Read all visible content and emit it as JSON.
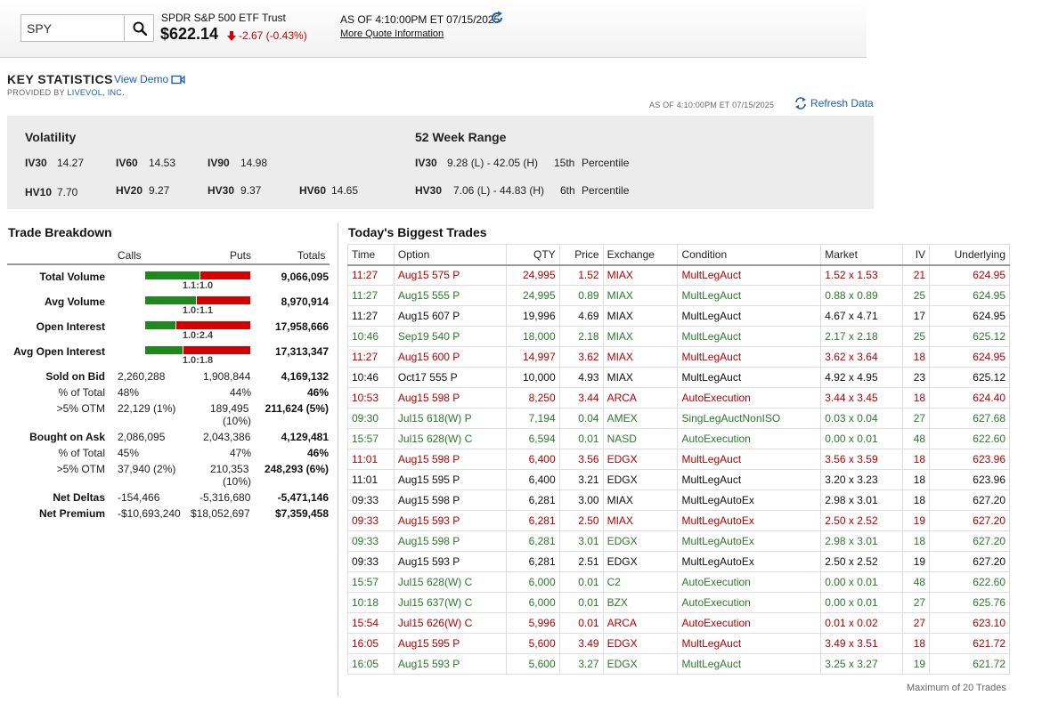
{
  "quote": {
    "symbol": "SPY",
    "name": "SPDR S&P 500 ETF Trust",
    "price": "$622.14",
    "change": "-2.67 (-0.43%)",
    "asof": "AS OF 4:10:00PM ET 07/15/2025",
    "more_info": "More Quote Information"
  },
  "key_stats": {
    "title": "KEY STATISTICS",
    "view_demo": "View Demo",
    "provided_by": "PROVIDED BY",
    "provider": "LIVEVOL, INC.",
    "asof": "AS OF 4:10:00PM ET 07/15/2025",
    "refresh": "Refresh Data",
    "volatility": {
      "heading": "Volatility",
      "iv30_label": "IV30",
      "iv30": "14.27",
      "iv60_label": "IV60",
      "iv60": "14.53",
      "iv90_label": "IV90",
      "iv90": "14.98",
      "hv10_label": "HV10",
      "hv10": "7.70",
      "hv20_label": "HV20",
      "hv20": "9.27",
      "hv30_label": "HV30",
      "hv30": "9.37",
      "hv60_label": "HV60",
      "hv60": "14.65"
    },
    "range52": {
      "heading": "52 Week Range",
      "iv30_label": "IV30",
      "iv30_range": "9.28 (L) - 42.05 (H)",
      "iv30_pct": "15th",
      "pct_label": "Percentile",
      "hv30_label": "HV30",
      "hv30_range": "7.06 (L) - 44.83 (H)",
      "hv30_pct": "6th"
    }
  },
  "trade_breakdown": {
    "title": "Trade Breakdown",
    "headers": {
      "calls": "Calls",
      "puts": "Puts",
      "totals": "Totals"
    },
    "bars": [
      {
        "label": "Total Volume",
        "ratio": "1.1:1.0",
        "calls_fraction": 0.52,
        "total": "9,066,095"
      },
      {
        "label": "Avg Volume",
        "ratio": "1.0:1.1",
        "calls_fraction": 0.48,
        "total": "8,970,914"
      },
      {
        "label": "Open Interest",
        "ratio": "1.0:2.4",
        "calls_fraction": 0.29,
        "total": "17,958,666"
      },
      {
        "label": "Avg Open Interest",
        "ratio": "1.0:1.8",
        "calls_fraction": 0.36,
        "total": "17,313,347"
      }
    ],
    "sold_on_bid": {
      "label": "Sold on Bid",
      "calls": "2,260,288",
      "puts": "1,908,844",
      "total": "4,169,132",
      "pct_label": "% of Total",
      "pct_calls": "48%",
      "pct_puts": "44%",
      "pct_total": "46%",
      "otm_label": ">5% OTM",
      "otm_calls": "22,129 (1%)",
      "otm_puts": "189,495",
      "otm_puts2": "(10%)",
      "otm_total": "211,624 (5%)"
    },
    "bought_on_ask": {
      "label": "Bought on Ask",
      "calls": "2,086,095",
      "puts": "2,043,386",
      "total": "4,129,481",
      "pct_label": "% of Total",
      "pct_calls": "45%",
      "pct_puts": "47%",
      "pct_total": "46%",
      "otm_label": ">5% OTM",
      "otm_calls": "37,940 (2%)",
      "otm_puts": "210,353",
      "otm_puts2": "(10%)",
      "otm_total": "248,293 (6%)"
    },
    "net_deltas": {
      "label": "Net Deltas",
      "calls": "-154,466",
      "puts": "-5,316,680",
      "total": "-5,471,146"
    },
    "net_premium": {
      "label": "Net Premium",
      "calls": "-$10,693,240",
      "puts": "$18,052,697",
      "total": "$7,359,458"
    }
  },
  "biggest_trades": {
    "title": "Today's Biggest Trades",
    "columns": [
      "Time",
      "Option",
      "QTY",
      "Price",
      "Exchange",
      "Condition",
      "Market",
      "IV",
      "Underlying"
    ],
    "rows": [
      {
        "tone": "red",
        "cells": [
          "11:27",
          "Aug15 575 P",
          "24,995",
          "1.52",
          "MIAX",
          "MultLegAuct",
          "1.52 x 1.53",
          "21",
          "624.95"
        ]
      },
      {
        "tone": "green",
        "cells": [
          "11:27",
          "Aug15 555 P",
          "24,995",
          "0.89",
          "MIAX",
          "MultLegAuct",
          "0.88 x 0.89",
          "25",
          "624.95"
        ]
      },
      {
        "tone": "black",
        "cells": [
          "11:27",
          "Aug15 607 P",
          "19,996",
          "4.69",
          "MIAX",
          "MultLegAuct",
          "4.67 x 4.71",
          "17",
          "624.95"
        ]
      },
      {
        "tone": "green",
        "cells": [
          "10:46",
          "Sep19 540 P",
          "18,000",
          "2.18",
          "MIAX",
          "MultLegAuct",
          "2.17 x 2.18",
          "25",
          "625.12"
        ]
      },
      {
        "tone": "red",
        "cells": [
          "11:27",
          "Aug15 600 P",
          "14,997",
          "3.62",
          "MIAX",
          "MultLegAuct",
          "3.62 x 3.64",
          "18",
          "624.95"
        ]
      },
      {
        "tone": "black",
        "cells": [
          "10:46",
          "Oct17 555 P",
          "10,000",
          "4.93",
          "MIAX",
          "MultLegAuct",
          "4.92 x 4.95",
          "23",
          "625.12"
        ]
      },
      {
        "tone": "red",
        "cells": [
          "10:53",
          "Aug15 598 P",
          "8,250",
          "3.44",
          "ARCA",
          "AutoExecution",
          "3.44 x 3.45",
          "18",
          "624.40"
        ]
      },
      {
        "tone": "green",
        "cells": [
          "09:30",
          "Jul15 618(W) P",
          "7,194",
          "0.04",
          "AMEX",
          "SingLegAuctNonISO",
          "0.03 x 0.04",
          "27",
          "627.68"
        ]
      },
      {
        "tone": "green",
        "cells": [
          "15:57",
          "Jul15 628(W) C",
          "6,594",
          "0.01",
          "NASD",
          "AutoExecution",
          "0.00 x 0.01",
          "48",
          "622.60"
        ]
      },
      {
        "tone": "red",
        "cells": [
          "11:01",
          "Aug15 598 P",
          "6,400",
          "3.56",
          "EDGX",
          "MultLegAuct",
          "3.56 x 3.59",
          "18",
          "623.96"
        ]
      },
      {
        "tone": "black",
        "cells": [
          "11:01",
          "Aug15 595 P",
          "6,400",
          "3.21",
          "EDGX",
          "MultLegAuct",
          "3.20 x 3.23",
          "18",
          "623.96"
        ]
      },
      {
        "tone": "black",
        "cells": [
          "09:33",
          "Aug15 598 P",
          "6,281",
          "3.00",
          "MIAX",
          "MultLegAutoEx",
          "2.98 x 3.01",
          "18",
          "627.20"
        ]
      },
      {
        "tone": "red",
        "cells": [
          "09:33",
          "Aug15 593 P",
          "6,281",
          "2.50",
          "MIAX",
          "MultLegAutoEx",
          "2.50 x 2.52",
          "19",
          "627.20"
        ]
      },
      {
        "tone": "green",
        "cells": [
          "09:33",
          "Aug15 598 P",
          "6,281",
          "3.01",
          "EDGX",
          "MultLegAutoEx",
          "2.98 x 3.01",
          "18",
          "627.20"
        ]
      },
      {
        "tone": "black",
        "cells": [
          "09:33",
          "Aug15 593 P",
          "6,281",
          "2.51",
          "EDGX",
          "MultLegAutoEx",
          "2.50 x 2.52",
          "19",
          "627.20"
        ]
      },
      {
        "tone": "green",
        "cells": [
          "15:57",
          "Jul15 628(W) C",
          "6,000",
          "0.01",
          "C2",
          "AutoExecution",
          "0.00 x 0.01",
          "48",
          "622.60"
        ]
      },
      {
        "tone": "green",
        "cells": [
          "10:18",
          "Jul15 637(W) C",
          "6,000",
          "0.01",
          "BZX",
          "AutoExecution",
          "0.00 x 0.01",
          "27",
          "625.76"
        ]
      },
      {
        "tone": "red",
        "cells": [
          "15:54",
          "Jul15 626(W) C",
          "5,996",
          "0.01",
          "ARCA",
          "AutoExecution",
          "0.01 x 0.02",
          "27",
          "623.10"
        ]
      },
      {
        "tone": "red",
        "cells": [
          "16:05",
          "Aug15 595 P",
          "5,600",
          "3.49",
          "EDGX",
          "MultLegAuct",
          "3.49 x 3.51",
          "18",
          "621.72"
        ]
      },
      {
        "tone": "green",
        "cells": [
          "16:05",
          "Aug15 593 P",
          "5,600",
          "3.27",
          "EDGX",
          "MultLegAuct",
          "3.25 x 3.27",
          "19",
          "621.72"
        ]
      }
    ],
    "footer": "Maximum of 20 Trades"
  },
  "colors": {
    "up": "#2a7a2a",
    "down": "#b30000",
    "link": "#1a5fb4",
    "bar_calls": "#1e8a1e",
    "bar_puts": "#d40000"
  }
}
